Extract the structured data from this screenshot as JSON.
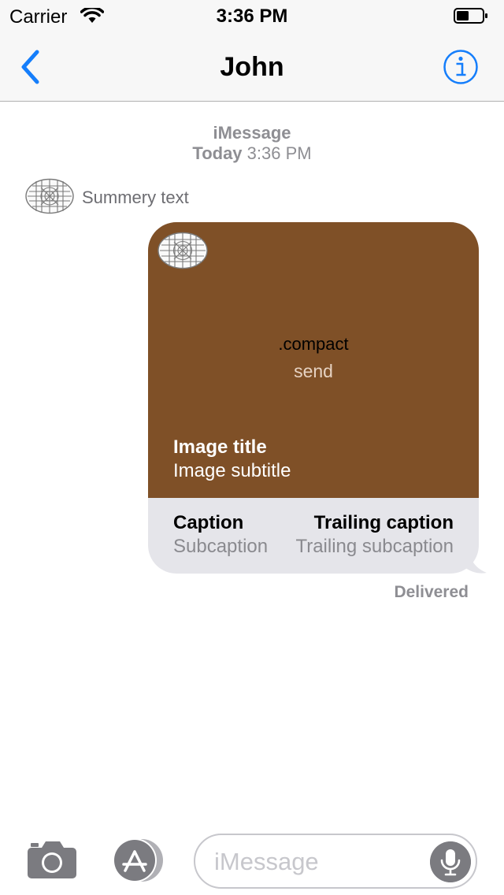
{
  "status_bar": {
    "carrier": "Carrier",
    "time": "3:36 PM"
  },
  "nav": {
    "title": "John",
    "back_icon": "chevron-left-icon",
    "info_icon": "info-icon",
    "accent": "#157efb"
  },
  "thread": {
    "service": "iMessage",
    "date_day": "Today",
    "date_time": "3:36 PM"
  },
  "summary": {
    "text": "Summery text",
    "icon": "placeholder-image-icon"
  },
  "message": {
    "background": "#7f5027",
    "center_label": ".compact",
    "center_sub": "send",
    "image_title": "Image title",
    "image_subtitle": "Image subtitle",
    "caption": "Caption",
    "subcaption": "Subcaption",
    "trailing_caption": "Trailing caption",
    "trailing_subcaption": "Trailing subcaption",
    "status": "Delivered"
  },
  "input_bar": {
    "placeholder": "iMessage",
    "camera_icon": "camera-icon",
    "apps_icon": "app-store-icon",
    "mic_icon": "microphone-icon"
  }
}
